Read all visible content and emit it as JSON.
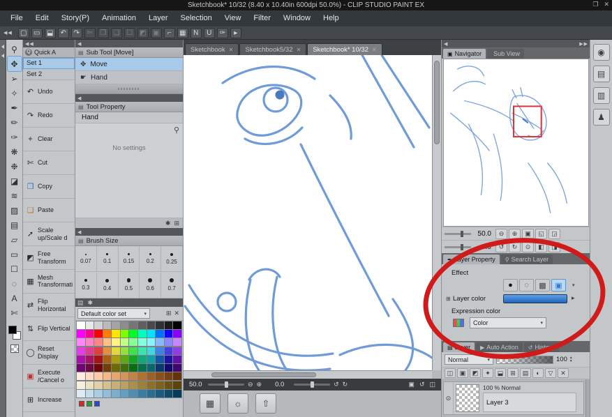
{
  "colors": {
    "accent_blue": "#2f7cd6",
    "selection_blue": "#aecbe8",
    "sketch_blue": "#6f9bd8",
    "annotation_red": "#d01b1b"
  },
  "ui": {
    "dropdown_arrow": "▾",
    "spinner_up": "▴",
    "spinner_down": "▾",
    "close_glyph": "✕"
  },
  "titlebar": {
    "title": "Sketchbook* 10/32 (8.40 x 10.40in 600dpi 50.0%) - CLIP STUDIO PAINT EX",
    "controls": [
      {
        "name": "restore-window-button",
        "glyph": "❐"
      },
      {
        "name": "close-window-button",
        "glyph": "✕"
      }
    ]
  },
  "menubar": {
    "items": [
      "File",
      "Edit",
      "Story(P)",
      "Animation",
      "Layer",
      "Selection",
      "View",
      "Filter",
      "Window",
      "Help"
    ]
  },
  "toolbar": {
    "collapse_arrows": "◀◀",
    "items": [
      {
        "name": "new-canvas-icon",
        "glyph": "▢",
        "dim": false
      },
      {
        "name": "open-file-icon",
        "glyph": "▭",
        "dim": false
      },
      {
        "name": "save-icon",
        "glyph": "⬓",
        "dim": false
      },
      {
        "name": "undo-icon",
        "glyph": "↶",
        "dim": false
      },
      {
        "name": "redo-icon",
        "glyph": "↷",
        "dim": false
      },
      {
        "name": "cut-icon",
        "glyph": "✄",
        "dim": true
      },
      {
        "name": "copy-icon",
        "glyph": "❐",
        "dim": true
      },
      {
        "name": "paste-icon",
        "glyph": "❏",
        "dim": true
      },
      {
        "name": "deselect-icon",
        "glyph": "☐",
        "dim": true
      },
      {
        "name": "invert-selection-icon",
        "glyph": "◩",
        "dim": true
      },
      {
        "name": "select-border-icon",
        "glyph": "▣",
        "dim": true
      },
      {
        "name": "snap-to-ruler-icon",
        "glyph": "⌐",
        "dim": false
      },
      {
        "name": "snap-to-grid-icon",
        "glyph": "▦",
        "dim": false
      },
      {
        "name": "special-ruler-icon",
        "glyph": "N",
        "dim": false
      },
      {
        "name": "vanishing-point-icon",
        "glyph": "U",
        "dim": false
      },
      {
        "name": "pen-pressure-icon",
        "glyph": "✑",
        "dim": false
      },
      {
        "name": "toolbar-more-icon",
        "glyph": "▸",
        "dim": false
      }
    ]
  },
  "tool_palette": {
    "tools": [
      {
        "name": "zoom-tool",
        "glyph": "⚲",
        "active": false
      },
      {
        "name": "move-tool",
        "glyph": "✥",
        "active": true
      },
      {
        "name": "operation-tool",
        "glyph": "➢",
        "active": false
      },
      {
        "name": "eyedropper-tool",
        "glyph": "✧",
        "active": false
      },
      {
        "name": "pen-tool",
        "glyph": "✒",
        "active": false
      },
      {
        "name": "pencil-tool",
        "glyph": "✏",
        "active": false
      },
      {
        "name": "brush-tool",
        "glyph": "✑",
        "active": false
      },
      {
        "name": "airbrush-tool",
        "glyph": "❋",
        "active": false
      },
      {
        "name": "decoration-tool",
        "glyph": "❉",
        "active": false
      },
      {
        "name": "eraser-tool",
        "glyph": "◪",
        "active": false
      },
      {
        "name": "blend-tool",
        "glyph": "≋",
        "active": false
      },
      {
        "name": "fill-tool",
        "glyph": "▨",
        "active": false
      },
      {
        "name": "gradient-tool",
        "glyph": "▤",
        "active": false
      },
      {
        "name": "figure-tool",
        "glyph": "▱",
        "active": false
      },
      {
        "name": "frame-border-tool",
        "glyph": "▭",
        "active": false
      },
      {
        "name": "selection-tool",
        "glyph": "☐",
        "active": false
      },
      {
        "name": "lasso-tool",
        "glyph": "◌",
        "active": false
      },
      {
        "name": "text-tool",
        "glyph": "A",
        "active": false
      },
      {
        "name": "correction-tool",
        "glyph": "✄",
        "active": false
      }
    ],
    "main_color": "#000000",
    "sub_color": "#ffffff"
  },
  "quick_access": {
    "dock_arrows": "◀◀",
    "tab_icon_glyph": "Q",
    "tab_label": "Quick A",
    "sets": [
      {
        "label": "Set 1",
        "active": true
      },
      {
        "label": "Set 2",
        "active": false
      }
    ],
    "items": [
      {
        "name": "undo-button",
        "label": "Undo",
        "glyph": "↶",
        "color": "#2a2a2a"
      },
      {
        "name": "redo-button",
        "label": "Redo",
        "glyph": "↷",
        "color": "#2a2a2a"
      },
      {
        "name": "clear-button",
        "label": "Clear",
        "glyph": "✦",
        "color": "#6a6e72"
      },
      {
        "name": "cut-button",
        "label": "Cut",
        "glyph": "✄",
        "color": "#2a2a2a"
      },
      {
        "name": "copy-button",
        "label": "Copy",
        "glyph": "❐",
        "color": "#2f6fc4"
      },
      {
        "name": "paste-button",
        "label": "Paste",
        "glyph": "❏",
        "color": "#b07828"
      },
      {
        "name": "scale-button",
        "label": "Scale up/Scale d",
        "glyph": "➚",
        "color": "#2a2a2a"
      },
      {
        "name": "free-transform-button",
        "label": "Free Transform",
        "glyph": "◩",
        "color": "#2a2a2a"
      },
      {
        "name": "mesh-transform-button",
        "label": "Mesh Transformation",
        "glyph": "▦",
        "color": "#2a2a2a"
      },
      {
        "name": "flip-horizontal-button",
        "label": "Flip Horizontal",
        "glyph": "⇄",
        "color": "#2a2a2a"
      },
      {
        "name": "flip-vertical-button",
        "label": "Flip Vertical",
        "glyph": "⇅",
        "color": "#2a2a2a"
      },
      {
        "name": "reset-display-button",
        "label": "Reset Display",
        "glyph": "◯",
        "color": "#2a2a2a"
      },
      {
        "name": "execute-cancel-button",
        "label": "Execute /Cancel o",
        "glyph": "▣",
        "color": "#c03030"
      },
      {
        "name": "increase-button",
        "label": "Increase",
        "glyph": "⊞",
        "color": "#2a2a2a"
      }
    ]
  },
  "sub_tool": {
    "dock_arrows": "◀",
    "header_glyph": "▤",
    "title": "Sub Tool [Move]",
    "items": [
      {
        "name": "subtool-move",
        "label": "Move",
        "glyph": "✥",
        "active": true
      },
      {
        "name": "subtool-hand",
        "label": "Hand",
        "glyph": "☛",
        "active": false
      }
    ]
  },
  "tool_property": {
    "dock_arrows": "◀",
    "header_glyph": "▤",
    "title": "Tool Property",
    "tool_name": "Hand",
    "empty_text": "No settings",
    "magnifier_glyph": "⚲",
    "footer_icons": [
      {
        "name": "wrench-icon",
        "glyph": "✱"
      },
      {
        "name": "add-setting-icon",
        "glyph": "⊞"
      }
    ]
  },
  "brush_size": {
    "dock_arrows": "◀",
    "header_glyph": "▤",
    "title": "Brush Size",
    "sizes": [
      {
        "v": "0.07",
        "d": "2px"
      },
      {
        "v": "0.1",
        "d": "2.5px"
      },
      {
        "v": "0.15",
        "d": "3px"
      },
      {
        "v": "0.2",
        "d": "3.5px"
      },
      {
        "v": "0.25",
        "d": "4px"
      },
      {
        "v": "0.3",
        "d": "4.5px"
      },
      {
        "v": "0.4",
        "d": "5px"
      },
      {
        "v": "0.5",
        "d": "5.5px"
      },
      {
        "v": "0.6",
        "d": "6px"
      },
      {
        "v": "0.7",
        "d": "6.5px"
      }
    ]
  },
  "color_set": {
    "header_icons": [
      {
        "name": "color-set-list-icon",
        "glyph": "▤"
      },
      {
        "name": "color-set-edit-icon",
        "glyph": "✱"
      }
    ],
    "selected_set": "Default color set",
    "row_icons": [
      {
        "name": "add-color-icon",
        "glyph": "⊞"
      },
      {
        "name": "delete-color-icon",
        "glyph": "✕"
      }
    ],
    "swatches": [
      "#ffffff",
      "#e9e9e9",
      "#d2d2d2",
      "#bbbbbb",
      "#a4a4a4",
      "#8d8d8d",
      "#767676",
      "#5f5f5f",
      "#484848",
      "#313131",
      "#1a1a1a",
      "#000000",
      "#ff00ff",
      "#ff0090",
      "#ff0000",
      "#ff7e00",
      "#ffe400",
      "#7eff00",
      "#00ff26",
      "#00ffbf",
      "#00e4ff",
      "#0072ff",
      "#1200ff",
      "#8c00ff",
      "#ff86ff",
      "#ff86c4",
      "#ff8686",
      "#ffc186",
      "#fff386",
      "#c1ff86",
      "#86ff97",
      "#86ffdf",
      "#86f3ff",
      "#86b9ff",
      "#8e86ff",
      "#c686ff",
      "#e23ee2",
      "#e23e90",
      "#e23e3e",
      "#e2903e",
      "#e2d73e",
      "#90e23e",
      "#3ee24e",
      "#3ee2ad",
      "#3ed7e2",
      "#3e83e2",
      "#483ee2",
      "#903ee2",
      "#a812a8",
      "#a81260",
      "#a81212",
      "#a86012",
      "#a89e12",
      "#60a812",
      "#12a822",
      "#12a87c",
      "#129ea8",
      "#1256a8",
      "#1c12a8",
      "#6012a8",
      "#6e086e",
      "#6e0840",
      "#6e0808",
      "#6e4008",
      "#6e6808",
      "#406e08",
      "#086e14",
      "#086e52",
      "#08686e",
      "#08386e",
      "#12086e",
      "#40086e",
      "#ffece0",
      "#ffdcc4",
      "#ffcba6",
      "#f4b98b",
      "#e5a671",
      "#d5945a",
      "#c48245",
      "#b27133",
      "#9f6024",
      "#8b5018",
      "#774110",
      "#63330a",
      "#f6efdd",
      "#ece0c2",
      "#e1d0a8",
      "#d5c08f",
      "#c8af77",
      "#baa061",
      "#ab904d",
      "#9c803b",
      "#8c702c",
      "#7c611f",
      "#6b5214",
      "#5a440c",
      "#dceaf4",
      "#c4dcec",
      "#abcde3",
      "#93bed9",
      "#7baecd",
      "#649ec0",
      "#4e8eb2",
      "#3a7da2",
      "#296d91",
      "#1a5c7f",
      "#0e4c6c",
      "#063c58"
    ],
    "recent": [
      "#d42a2a",
      "#2a9d2a",
      "#2a48c8"
    ]
  },
  "canvas": {
    "tabs": [
      {
        "label": "Sketchbook",
        "active": false
      },
      {
        "label": "Sketchbook5/32",
        "active": false
      },
      {
        "label": "Sketchbook* 10/32",
        "active": true
      }
    ],
    "statusbar": {
      "zoom_value": "50.0",
      "rotate_value": "0.0",
      "zoom_out_glyph": "⊖",
      "zoom_in_glyph": "⊕",
      "rotate_ccw_glyph": "↺",
      "rotate_cw_glyph": "↻",
      "right_icons": [
        {
          "name": "fit-screen-icon",
          "glyph": "▣"
        },
        {
          "name": "reset-view-icon",
          "glyph": "↺"
        },
        {
          "name": "flip-view-icon",
          "glyph": "◫"
        }
      ]
    },
    "workspace_buttons": [
      {
        "name": "tablet-mode-button",
        "glyph": "▦"
      },
      {
        "name": "hint-button",
        "glyph": "☼"
      },
      {
        "name": "publish-button",
        "glyph": "⇧"
      }
    ]
  },
  "navigator": {
    "dock_arrows_left": "◀",
    "dock_arrows_right": "▶▶",
    "tabs": [
      {
        "label": "Navigator",
        "glyph": "▣",
        "active": true
      },
      {
        "label": "Sub View",
        "glyph": "",
        "active": false
      }
    ],
    "zoom_value": "50.0",
    "rotate_value": "0.0",
    "zoom_icons": [
      {
        "name": "zoom-out-icon",
        "glyph": "⊖"
      },
      {
        "name": "zoom-in-icon",
        "glyph": "⊕"
      },
      {
        "name": "zoom-100-icon",
        "glyph": "▣"
      },
      {
        "name": "fit-to-window-icon",
        "glyph": "◱"
      },
      {
        "name": "fit-to-screen-icon",
        "glyph": "◲"
      }
    ],
    "rotate_icons": [
      {
        "name": "rotate-ccw-icon",
        "glyph": "↺"
      },
      {
        "name": "rotate-cw-icon",
        "glyph": "↻"
      },
      {
        "name": "reset-rotation-icon",
        "glyph": "⊙"
      },
      {
        "name": "flip-horizontal-icon",
        "glyph": "◧"
      },
      {
        "name": "flip-vertical-icon",
        "glyph": "◨"
      }
    ]
  },
  "layer_property": {
    "tabs": [
      {
        "label": "Layer Property",
        "glyph": "✒",
        "active": true
      },
      {
        "label": "Search Layer",
        "glyph": "⚲",
        "active": false
      }
    ],
    "effect_label": "Effect",
    "effect_buttons": [
      {
        "name": "border-effect-icon",
        "glyph": "●",
        "color": "#141414",
        "active": false
      },
      {
        "name": "tone-effect-icon",
        "glyph": "◌",
        "color": "#333639",
        "active": false
      },
      {
        "name": "extract-line-icon",
        "glyph": "▩",
        "color": "#44474a",
        "active": false
      },
      {
        "name": "layer-color-icon",
        "glyph": "▣",
        "color": "#2f7cd6",
        "active": true
      }
    ],
    "effect_more_glyph": "▾",
    "layer_color_expand_glyph": "⊞",
    "layer_color_label": "Layer color",
    "layer_color_value": "#2f7cd6",
    "layer_color_arrow": "▸",
    "expression_label": "Expression color",
    "expression_value": "Color"
  },
  "layer_panel": {
    "tabs": [
      {
        "label": "Layer",
        "glyph": "▤",
        "active": true
      },
      {
        "label": "Auto Action",
        "glyph": "▶",
        "active": false
      },
      {
        "label": "History",
        "glyph": "↺",
        "active": false
      }
    ],
    "blend_mode": "Normal",
    "opacity_value": "100",
    "tool_icons": [
      {
        "name": "set-transparency-icon",
        "glyph": "◫"
      },
      {
        "name": "lock-layer-icon",
        "glyph": "▣"
      },
      {
        "name": "lock-transparent-icon",
        "glyph": "◩"
      },
      {
        "name": "set-reference-icon",
        "glyph": "✦"
      },
      {
        "name": "clip-below-icon",
        "glyph": "⬓"
      },
      {
        "name": "new-raster-layer-icon",
        "glyph": "⊞"
      },
      {
        "name": "new-folder-icon",
        "glyph": "▤"
      },
      {
        "name": "create-mask-icon",
        "glyph": "◐"
      },
      {
        "name": "apply-mask-icon",
        "glyph": "▽"
      },
      {
        "name": "delete-layer-icon",
        "glyph": "✕"
      }
    ],
    "layer_info": "100 % Normal",
    "eye_glyph": "⊙",
    "layers": [
      {
        "name": "Layer 3",
        "visible": true
      }
    ]
  },
  "right_strip": {
    "buttons": [
      {
        "name": "clip-studio-button",
        "glyph": "◉"
      },
      {
        "name": "reference-panel-button",
        "glyph": "▤"
      },
      {
        "name": "material-panel-button",
        "glyph": "▥"
      },
      {
        "name": "pose-panel-button",
        "glyph": "♟"
      }
    ]
  }
}
